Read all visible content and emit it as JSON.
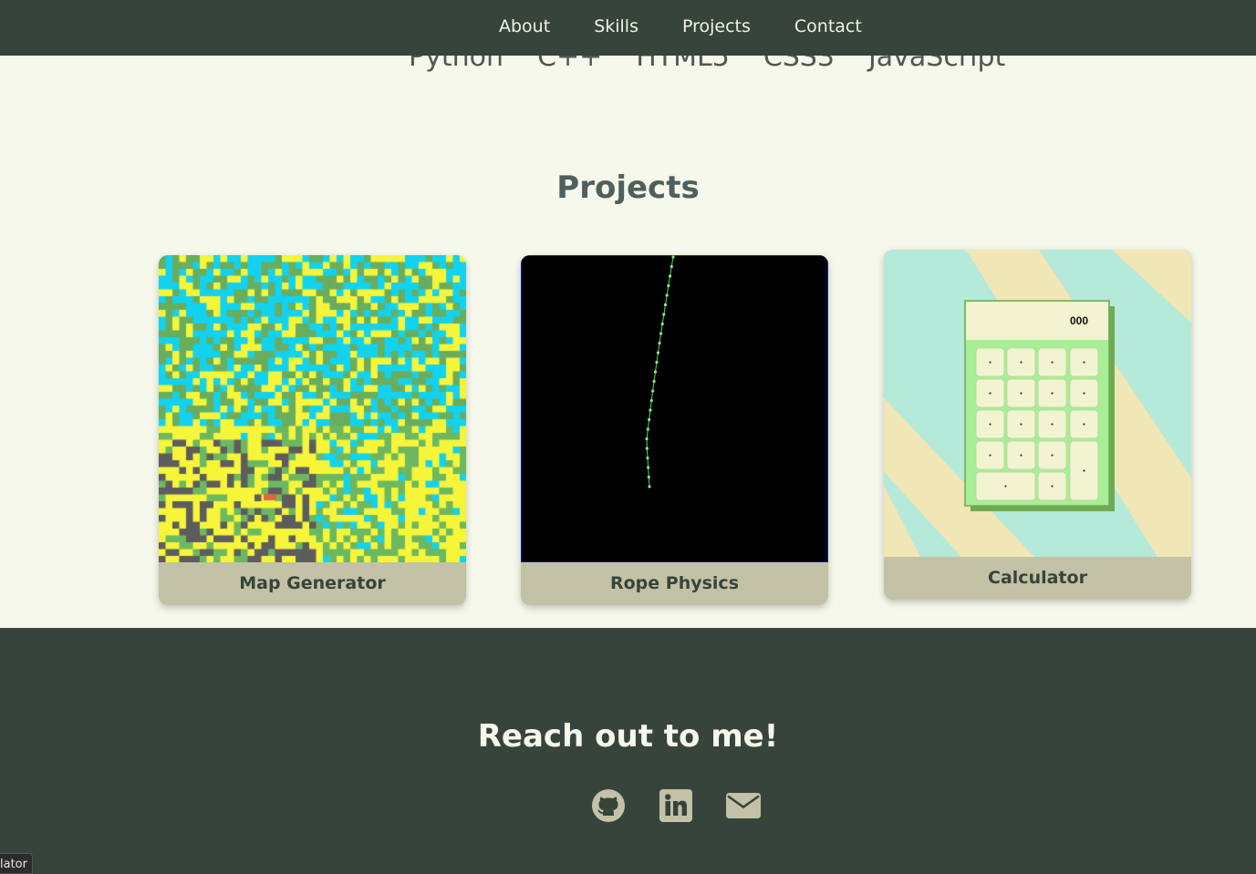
{
  "nav": {
    "items": [
      "About",
      "Skills",
      "Projects",
      "Contact"
    ]
  },
  "skills": [
    "Python",
    "C++",
    "HTML5",
    "CSS3",
    "JavaScript"
  ],
  "projects": {
    "title": "Projects",
    "cards": [
      {
        "label": "Map Generator"
      },
      {
        "label": "Rope Physics"
      },
      {
        "label": "Calculator",
        "display": "000"
      }
    ]
  },
  "footer": {
    "title": "Reach out to me!",
    "icons": [
      "github-icon",
      "linkedin-icon",
      "email-icon"
    ]
  },
  "status_tooltip": "lator",
  "colors": {
    "nav_bg": "#36443b",
    "page_bg": "#f5f8ea",
    "card_label_bg": "#c3c2a6",
    "icon_color": "#c3c2a6"
  }
}
